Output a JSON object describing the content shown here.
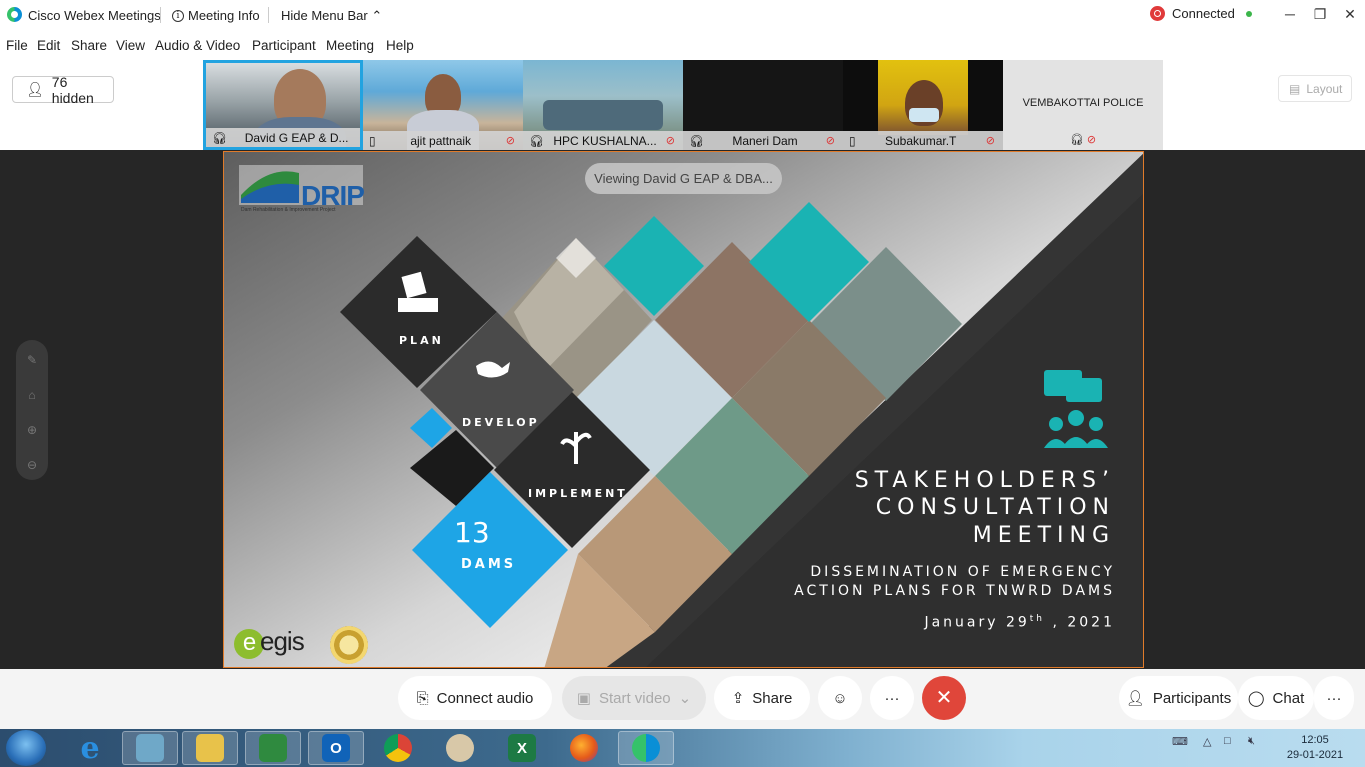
{
  "titlebar": {
    "app_name": "Cisco Webex Meetings",
    "meeting_info": "Meeting Info",
    "hide_menu_bar": "Hide Menu Bar",
    "status": "Connected",
    "minimize": "─",
    "restore": "❐",
    "close": "✕"
  },
  "menu": [
    "File",
    "Edit",
    "Share",
    "View",
    "Audio & Video",
    "Participant",
    "Meeting",
    "Help"
  ],
  "strip": {
    "hidden_count": "76 hidden",
    "layout": "Layout",
    "participants": [
      {
        "name": "David G EAP & D..."
      },
      {
        "name": "ajit pattnaik"
      },
      {
        "name": "HPC KUSHALNA..."
      },
      {
        "name": "Maneri Dam"
      },
      {
        "name": "Subakumar.T"
      },
      {
        "name": "VEMBAKOTTAI POLICE"
      }
    ]
  },
  "share": {
    "viewing": "Viewing David G EAP & DBA...",
    "logo_text": "DRIP",
    "logo_subtitle": "Dam Rehabilitation & Improvement Project",
    "diamonds": {
      "plan": "PLAN",
      "develop": "DEVELOP",
      "implement": "IMPLEMENT",
      "dams_count": "13",
      "dams_label": "DAMS"
    },
    "title_line1": "STAKEHOLDERS’",
    "title_line2": "CONSULTATION",
    "title_line3": "MEETING",
    "subtitle_line1": "DISSEMINATION OF EMERGENCY",
    "subtitle_line2": "ACTION PLANS FOR TNWRD DAMS",
    "date_prefix": "January 29",
    "date_sup": "th",
    "date_suffix": " , 2021",
    "egis_logo": "egis",
    "colors": {
      "teal": "#1ab3b3",
      "blue": "#1ea5e6",
      "dark": "#2e2e2e",
      "accent_border": "#e07b2a"
    }
  },
  "controls": {
    "connect_audio": "Connect audio",
    "start_video": "Start video",
    "share": "Share",
    "more": "···",
    "participants": "Participants",
    "chat": "Chat",
    "end_color": "#e0463a"
  },
  "taskbar": {
    "apps": [
      "internet-explorer",
      "notepad",
      "file-explorer",
      "task-manager",
      "outlook",
      "chrome",
      "paint",
      "excel",
      "firefox",
      "webex"
    ],
    "time": "12:05",
    "date": "29-01-2021"
  }
}
